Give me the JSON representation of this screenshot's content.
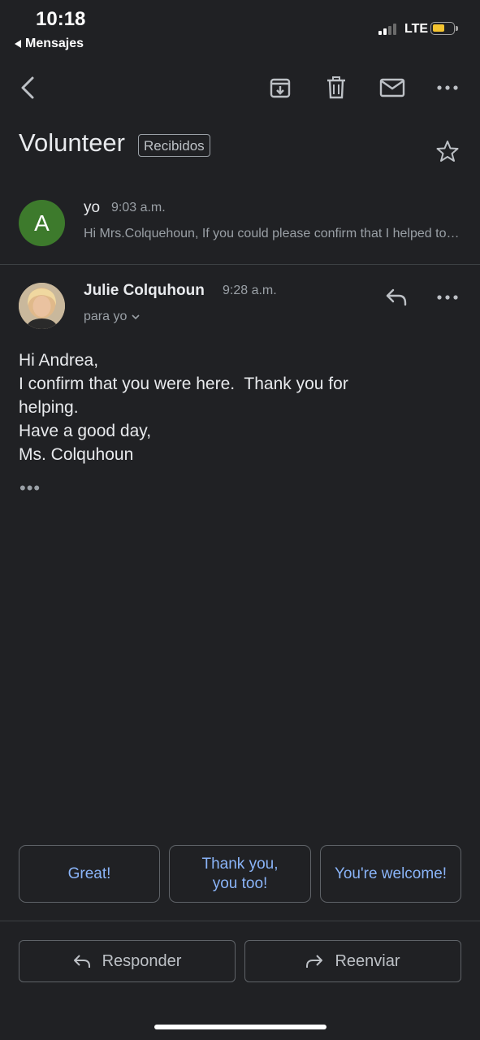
{
  "status_bar": {
    "time": "10:18",
    "back_app": "Mensajes",
    "network": "LTE"
  },
  "toolbar": {
    "back_icon": "back-arrow-icon",
    "archive_icon": "archive-icon",
    "delete_icon": "trash-icon",
    "unread_icon": "mail-icon",
    "more_icon": "more-horizontal-icon"
  },
  "thread": {
    "subject": "Volunteer",
    "label": "Recibidos",
    "star_icon": "star-outline-icon"
  },
  "messages": [
    {
      "avatar_letter": "A",
      "sender": "yo",
      "time": "9:03 a.m.",
      "snippet": "Hi Mrs.Colquehoun, If you could please confirm that I helped today"
    },
    {
      "sender": "Julie Colquhoun",
      "time": "9:28 a.m.",
      "to": "para yo",
      "body_lines": [
        "Hi Andrea,",
        "I confirm that you were here.  Thank you for",
        "helping.",
        "Have a good day,",
        "Ms. Colquhoun"
      ],
      "trimmed": "•••"
    }
  ],
  "smart_replies": [
    {
      "line1": "Great!",
      "line2": ""
    },
    {
      "line1": "Thank you,",
      "line2": "you too!"
    },
    {
      "line1": "You're welcome!",
      "line2": ""
    }
  ],
  "actions": {
    "reply": "Responder",
    "forward": "Reenviar"
  },
  "colors": {
    "background": "#202124",
    "accent": "#8ab4f8",
    "avatar": "#3d7a2c",
    "battery": "#f4c430"
  }
}
